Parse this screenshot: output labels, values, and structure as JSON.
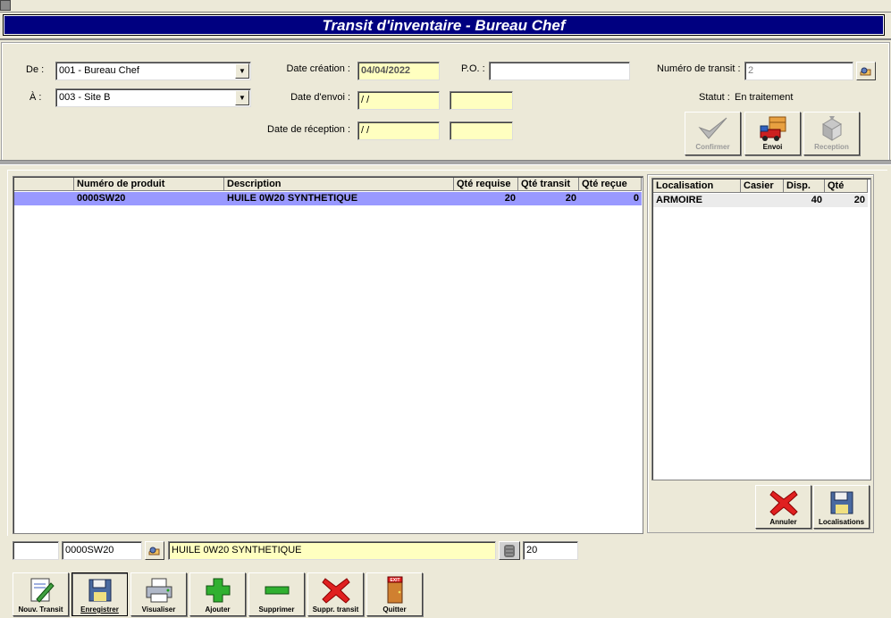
{
  "window": {
    "title": "Transit d'inventaire - Bureau Chef"
  },
  "header": {
    "from_label": "De :",
    "from_value": "001 - Bureau Chef",
    "to_label": "À :",
    "to_value": "003 - Site B",
    "creation_date_label": "Date création :",
    "creation_date_value": "04/04/2022",
    "send_date_label": "Date d'envoi :",
    "send_date_value": "/ /",
    "send_extra_value": "",
    "receipt_date_label": "Date de réception :",
    "receipt_date_value": "/ /",
    "receipt_extra_value": "",
    "po_label": "P.O. :",
    "po_value": "",
    "transit_number_label": "Numéro de transit :",
    "transit_number_value": "2",
    "status_label": "Statut :",
    "status_value": "En traitement"
  },
  "action_buttons": {
    "confirm": "Confirmer",
    "send": "Envoi",
    "receive": "Reception"
  },
  "products_table": {
    "columns": [
      "",
      "Numéro de produit",
      "Description",
      "Qté requise",
      "Qté transit",
      "Qté reçue"
    ],
    "rows": [
      {
        "code": "0000SW20",
        "description": "HUILE 0W20 SYNTHETIQUE",
        "required": "20",
        "transit": "20",
        "received": "0"
      }
    ]
  },
  "locations_table": {
    "columns": [
      "Localisation",
      "Casier",
      "Disp.",
      "Qté"
    ],
    "rows": [
      {
        "location": "ARMOIRE",
        "bin": "",
        "available": "40",
        "qty": "20"
      }
    ]
  },
  "location_buttons": {
    "cancel": "Annuler",
    "locations": "Localisations"
  },
  "entry": {
    "field1": "",
    "code": "0000SW20",
    "description": "HUILE 0W20 SYNTHETIQUE",
    "quantity": "20"
  },
  "toolbar": {
    "new": "Nouv. Transit",
    "save": "Enregistrer",
    "view": "Visualiser",
    "add": "Ajouter",
    "delete": "Supprimer",
    "delete_transit": "Suppr. transit",
    "quit": "Quitter"
  },
  "colors": {
    "title_band": "#000080",
    "selected_row": "#9999ff",
    "date_field": "#ffffc0",
    "window_bg": "#ece9d8"
  }
}
